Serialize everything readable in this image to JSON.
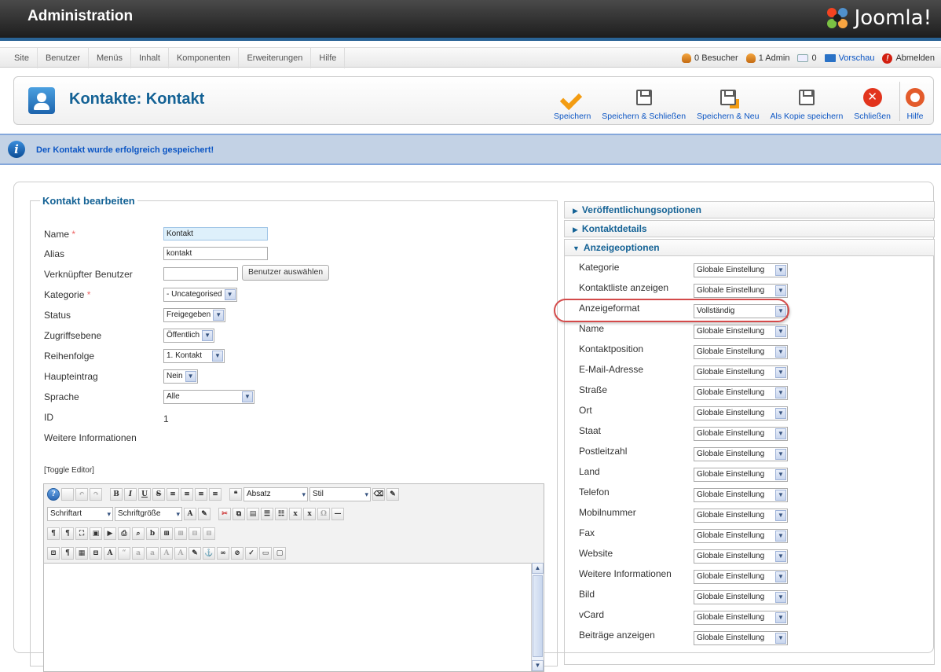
{
  "header": {
    "title": "Administration",
    "logo_text": "Joomla!"
  },
  "menubar": {
    "items": [
      "Site",
      "Benutzer",
      "Menüs",
      "Inhalt",
      "Komponenten",
      "Erweiterungen",
      "Hilfe"
    ],
    "status": {
      "visitors": "0 Besucher",
      "admins": "1 Admin",
      "messages": "0",
      "preview": "Vorschau",
      "logout": "Abmelden"
    }
  },
  "toolbar": {
    "page_title": "Kontakte: Kontakt",
    "buttons": {
      "save": "Speichern",
      "save_close": "Speichern & Schließen",
      "save_new": "Speichern & Neu",
      "save_copy": "Als Kopie speichern",
      "close": "Schließen",
      "help": "Hilfe"
    }
  },
  "message": {
    "text": "Der Kontakt wurde erfolgreich gespeichert!"
  },
  "form": {
    "legend": "Kontakt bearbeiten",
    "name_label": "Name",
    "name_value": "Kontakt",
    "alias_label": "Alias",
    "alias_value": "kontakt",
    "user_label": "Verknüpfter Benutzer",
    "user_value": "",
    "user_button": "Benutzer auswählen",
    "category_label": "Kategorie",
    "category_value": "- Uncategorised",
    "status_label": "Status",
    "status_value": "Freigegeben",
    "access_label": "Zugriffsebene",
    "access_value": "Öffentlich",
    "order_label": "Reihenfolge",
    "order_value": "1. Kontakt",
    "featured_label": "Haupteintrag",
    "featured_value": "Nein",
    "language_label": "Sprache",
    "language_value": "Alle",
    "id_label": "ID",
    "id_value": "1",
    "misc_label": "Weitere Informationen",
    "required_mark": "*",
    "toggle_editor": "[Toggle Editor]"
  },
  "editor": {
    "format_select": "Absatz",
    "style_select": "Stil",
    "font_select": "Schriftart",
    "size_select": "Schriftgröße",
    "glyphs": {
      "help": "?",
      "bold": "B",
      "italic": "I",
      "underline": "U",
      "strike": "S",
      "quote": "❝",
      "paragraph": "¶"
    }
  },
  "accordion": {
    "publishing": "Veröffentlichungsoptionen",
    "details": "Kontaktdetails",
    "display": "Anzeigeoptionen",
    "display_rows": [
      {
        "label": "Kategorie",
        "value": "Globale Einstellung"
      },
      {
        "label": "Kontaktliste anzeigen",
        "value": "Globale Einstellung"
      },
      {
        "label": "Anzeigeformat",
        "value": "Vollständig"
      },
      {
        "label": "Name",
        "value": "Globale Einstellung"
      },
      {
        "label": "Kontaktposition",
        "value": "Globale Einstellung"
      },
      {
        "label": "E-Mail-Adresse",
        "value": "Globale Einstellung"
      },
      {
        "label": "Straße",
        "value": "Globale Einstellung"
      },
      {
        "label": "Ort",
        "value": "Globale Einstellung"
      },
      {
        "label": "Staat",
        "value": "Globale Einstellung"
      },
      {
        "label": "Postleitzahl",
        "value": "Globale Einstellung"
      },
      {
        "label": "Land",
        "value": "Globale Einstellung"
      },
      {
        "label": "Telefon",
        "value": "Globale Einstellung"
      },
      {
        "label": "Mobilnummer",
        "value": "Globale Einstellung"
      },
      {
        "label": "Fax",
        "value": "Globale Einstellung"
      },
      {
        "label": "Website",
        "value": "Globale Einstellung"
      },
      {
        "label": "Weitere Informationen",
        "value": "Globale Einstellung"
      },
      {
        "label": "Bild",
        "value": "Globale Einstellung"
      },
      {
        "label": "vCard",
        "value": "Globale Einstellung"
      },
      {
        "label": "Beiträge anzeigen",
        "value": "Globale Einstellung"
      }
    ]
  },
  "colors": {
    "brand_blue": "#146295",
    "link_blue": "#0b55c4",
    "message_bg": "#c3d2e5",
    "highlight_red": "#d44a4a",
    "save_orange": "#f39c12"
  }
}
